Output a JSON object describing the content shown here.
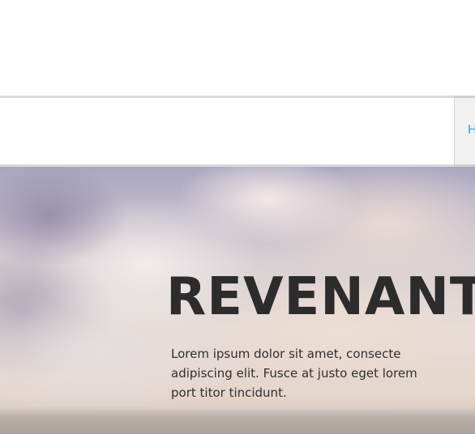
{
  "nav": {
    "tab_label": "H"
  },
  "hero": {
    "title": "REVENANT I",
    "text": "Lorem ipsum dolor sit amet, consecte adipiscing elit. Fusce at justo eget lorem port titor tincidunt."
  },
  "colors": {
    "nav_link": "#35a8d6",
    "title_text": "#2c2c2c",
    "divider": "#d9d9d9"
  }
}
